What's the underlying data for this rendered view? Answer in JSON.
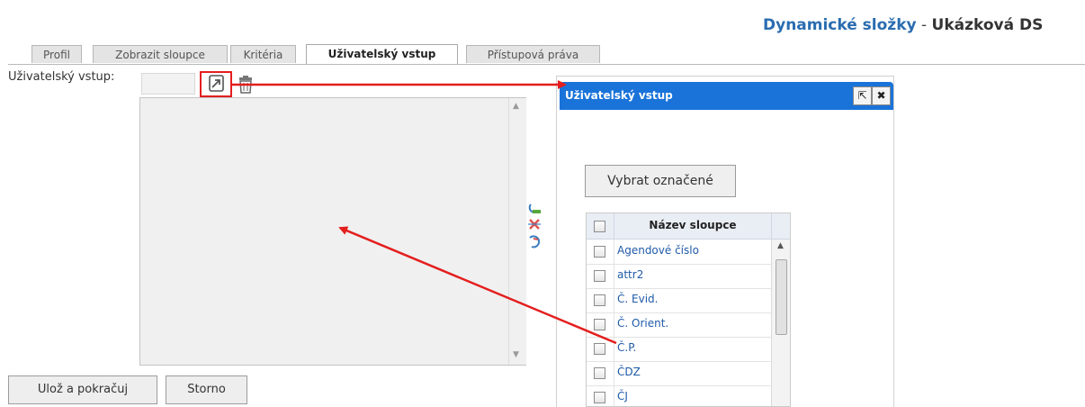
{
  "top_banner_text": "",
  "title": {
    "part1": "Dynamické složky",
    "separator": " - ",
    "part2": "Ukázková DS"
  },
  "tabs": [
    {
      "label": "Profil"
    },
    {
      "label": "Zobrazit sloupce"
    },
    {
      "label": "Kritéria"
    },
    {
      "label": "Uživatelský vstup",
      "active": true
    },
    {
      "label": "Přístupová práva"
    }
  ],
  "user_input": {
    "label": "Uživatelský vstup:",
    "value": ""
  },
  "icons": {
    "pick": "pick-column-icon",
    "delete": "trash-icon",
    "side": [
      "add-icon",
      "remove-icon",
      "refresh-icon"
    ]
  },
  "buttons": {
    "save_continue": "Ulož a pokračuj",
    "cancel": "Storno"
  },
  "dialog": {
    "title": "Uživatelský vstup",
    "select_marked": "Vybrat označené",
    "column_header": "Název sloupce",
    "rows": [
      "Agendové číslo",
      "attr2",
      "Č. Evid.",
      "Č. Orient.",
      "Č.P.",
      "ČDZ",
      "ČJ"
    ]
  },
  "colors": {
    "accent_blue": "#1a73d9",
    "annotation_red": "#e41e1e",
    "title_blue": "#2a6cb0"
  }
}
